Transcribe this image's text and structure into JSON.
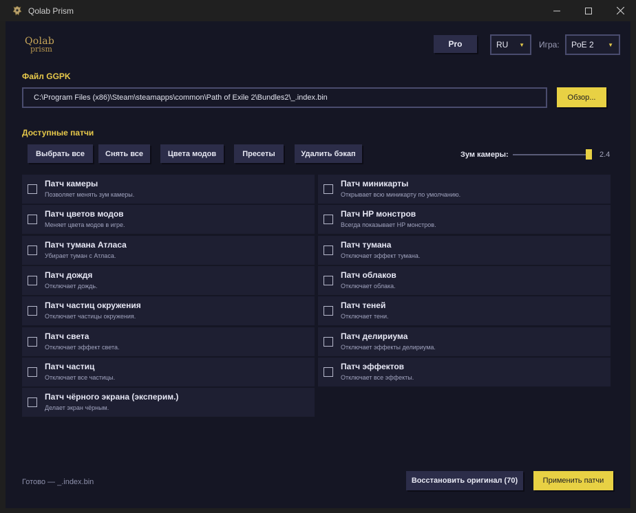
{
  "window": {
    "title": "Qolab Prism",
    "app_icon": "dragon-logo-icon",
    "controls": [
      "minimize-icon",
      "maximize-icon",
      "close-icon"
    ]
  },
  "logo": {
    "line1": "Qolab",
    "line2": "prism"
  },
  "header": {
    "pro_label": "Pro",
    "language": {
      "value": "RU"
    },
    "game_label": "Игра:",
    "game": {
      "value": "PoE 2"
    }
  },
  "ggpk": {
    "label": "Файл GGPK",
    "path": "C:\\Program Files (x86)\\Steam\\steamapps\\common\\Path of Exile 2\\Bundles2\\_.index.bin",
    "browse_label": "Обзор..."
  },
  "patches": {
    "label": "Доступные патчи",
    "toolbar": {
      "select_all": "Выбрать все",
      "deselect_all": "Снять все",
      "mod_colors": "Цвета модов",
      "presets": "Пресеты",
      "delete_backup": "Удалить бэкап"
    },
    "zoom": {
      "label": "Зум камеры:",
      "value": "2.4",
      "level": 0.95
    },
    "items": [
      {
        "title": "Патч камеры",
        "desc": "Позволяет менять зум камеры.",
        "checked": false
      },
      {
        "title": "Патч миникарты",
        "desc": "Открывает всю миникарту по умолчанию.",
        "checked": false
      },
      {
        "title": "Патч цветов модов",
        "desc": "Меняет цвета модов в игре.",
        "checked": false
      },
      {
        "title": "Патч HP монстров",
        "desc": "Всегда показывает HP монстров.",
        "checked": false
      },
      {
        "title": "Патч тумана Атласа",
        "desc": "Убирает туман с Атласа.",
        "checked": false
      },
      {
        "title": "Патч тумана",
        "desc": "Отключает эффект тумана.",
        "checked": false
      },
      {
        "title": "Патч дождя",
        "desc": "Отключает дождь.",
        "checked": false
      },
      {
        "title": "Патч облаков",
        "desc": "Отключает облака.",
        "checked": false
      },
      {
        "title": "Патч частиц окружения",
        "desc": "Отключает частицы окружения.",
        "checked": false
      },
      {
        "title": "Патч теней",
        "desc": "Отключает тени.",
        "checked": false
      },
      {
        "title": "Патч света",
        "desc": "Отключает эффект света.",
        "checked": false
      },
      {
        "title": "Патч делириума",
        "desc": "Отключает эффекты делириума.",
        "checked": false
      },
      {
        "title": "Патч частиц",
        "desc": "Отключает все частицы.",
        "checked": false
      },
      {
        "title": "Патч эффектов",
        "desc": "Отключает все эффекты.",
        "checked": false
      },
      {
        "title": "Патч чёрного экрана (эксперим.)",
        "desc": "Делает экран чёрным.",
        "checked": false
      }
    ]
  },
  "footer": {
    "status": "Готово — _.index.bin",
    "restore_label": "Восстановить оригинал (70)",
    "apply_label": "Применить патчи"
  },
  "colors": {
    "background": "#151624",
    "card": "#1e1f32",
    "button": "#2c2d49",
    "accent": "#e8d144",
    "section_label": "#e6c84a"
  }
}
